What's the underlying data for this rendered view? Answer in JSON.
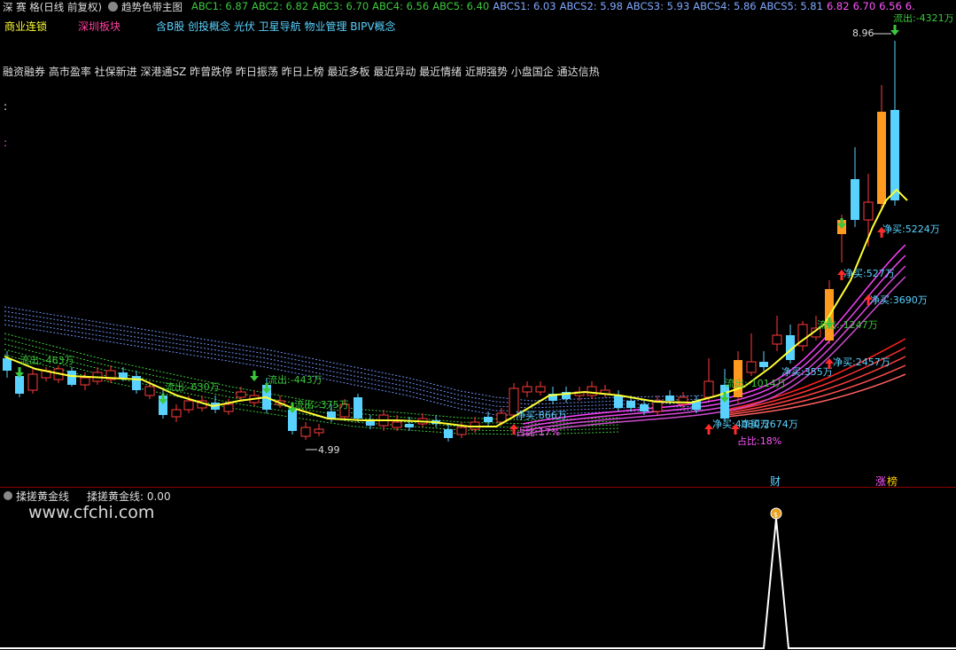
{
  "header": {
    "title": "深 赛 格(日线 前复权)",
    "formula_name": "趋势色带主图",
    "indicators": [
      {
        "label": "ABC1: 6.87",
        "color": "#3cc83c"
      },
      {
        "label": "ABC2: 6.82",
        "color": "#3cc83c"
      },
      {
        "label": "ABC3: 6.70",
        "color": "#3cc83c"
      },
      {
        "label": "ABC4: 6.56",
        "color": "#3cc83c"
      },
      {
        "label": "ABC5: 6.40",
        "color": "#3cc83c"
      },
      {
        "label": "ABCS1: 6.03",
        "color": "#7fa8ff"
      },
      {
        "label": "ABCS2: 5.98",
        "color": "#7fa8ff"
      },
      {
        "label": "ABCS3: 5.93",
        "color": "#7fa8ff"
      },
      {
        "label": "ABCS4: 5.86",
        "color": "#7fa8ff"
      },
      {
        "label": "ABCS5: 5.81",
        "color": "#7fa8ff"
      },
      {
        "label": "6.82",
        "color": "#ff55ff"
      },
      {
        "label": "6.70",
        "color": "#ff55ff"
      },
      {
        "label": "6.56",
        "color": "#ff55ff"
      },
      {
        "label": "6.",
        "color": "#ff55ff"
      }
    ]
  },
  "tags": {
    "industry": "商业连锁",
    "region": "深圳板块",
    "concepts": "含B股 创投概念 光伏 卫星导航 物业管理 BIPV概念",
    "styles": "融资融券 高市盈率 社保新进 深港通SZ 昨曾跌停 昨日振荡 昨日上榜 最近多板 最近异动 最近情绪 近期强势 小盘国企 通达信热"
  },
  "chart": {
    "high_label": "8.96",
    "low_label": "4.99",
    "outflow_top": "流出:-4321万",
    "annotations": [
      {
        "text": "流出:-463万",
        "color": "#3cc83c"
      },
      {
        "text": "流出:-630万",
        "color": "#3cc83c"
      },
      {
        "text": "流出:-443万",
        "color": "#3cc83c"
      },
      {
        "text": "流出:-375万",
        "color": "#3cc83c"
      },
      {
        "text": "流出:-1247万",
        "color": "#3cc83c"
      },
      {
        "text": "流出:-1014万",
        "color": "#3cc83c"
      },
      {
        "text": "净买:866万",
        "color": "#5ad2ff"
      },
      {
        "text": "占比:17%",
        "color": "#ff55ff"
      },
      {
        "text": "净买:2674万",
        "color": "#5ad2ff"
      },
      {
        "text": "净买:4030万",
        "color": "#5ad2ff"
      },
      {
        "text": "占比:18%",
        "color": "#ff55ff"
      },
      {
        "text": "净买:355万",
        "color": "#5ad2ff"
      },
      {
        "text": "净买:2457万",
        "color": "#5ad2ff"
      },
      {
        "text": "净买:3690万",
        "color": "#5ad2ff"
      },
      {
        "text": "净买:527万",
        "color": "#5ad2ff"
      },
      {
        "text": "净买:5224万",
        "color": "#5ad2ff"
      }
    ],
    "badge_cai": "财",
    "badge_zhang": "涨",
    "badge_bang": "榜"
  },
  "sub": {
    "title": "揉搓黄金线",
    "value_label": "揉搓黄金线: 0.00",
    "watermark": "www.cfchi.com"
  },
  "colors": {
    "up": "#ff3b3b",
    "down": "#5ad2ff",
    "ma": "#ffff33",
    "panel_border": "#8b0000"
  }
}
